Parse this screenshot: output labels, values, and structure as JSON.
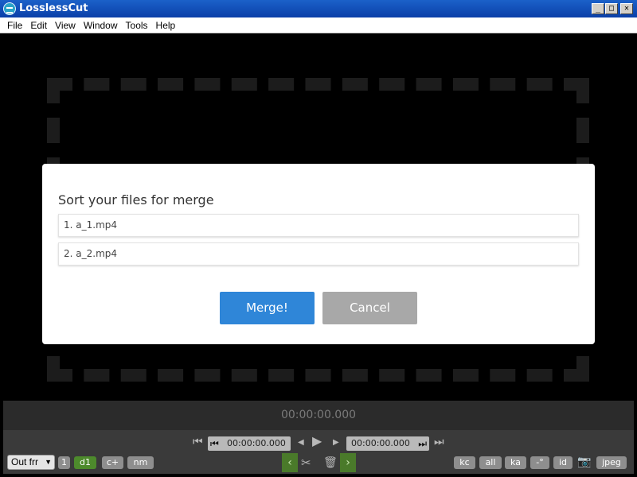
{
  "window": {
    "title": "LosslessCut",
    "icon": "losslesscut-app-icon"
  },
  "menu": [
    "File",
    "Edit",
    "View",
    "Window",
    "Tools",
    "Help"
  ],
  "dialog": {
    "title": "Sort your files for merge",
    "files": [
      "1. a_1.mp4",
      "2. a_2.mp4"
    ],
    "merge_label": "Merge!",
    "cancel_label": "Cancel"
  },
  "playback": {
    "current_time": "00:00:00.000",
    "cut_start_time": "00:00:00.000",
    "cut_end_time": "00:00:00.000"
  },
  "toolbar": {
    "output_format_select": "Out frr",
    "segment_number": "1",
    "left_buttons": [
      "d1",
      "c+",
      "nm"
    ],
    "right_buttons": [
      "kc",
      "all",
      "ka",
      "-°",
      "id",
      "jpeg"
    ]
  },
  "colors": {
    "merge_button": "#2f86d8",
    "cancel_button": "#a8a8a8",
    "active_toggle": "#4d8a2c",
    "titlebar": "#1b61c9"
  }
}
